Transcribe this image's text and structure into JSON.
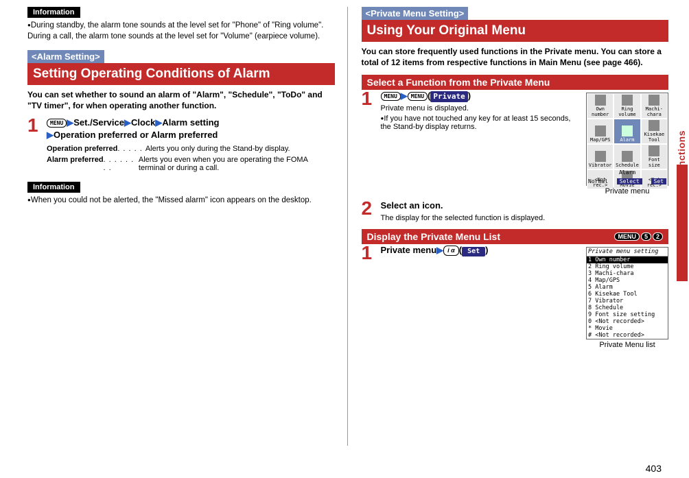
{
  "left": {
    "info1_label": "Information",
    "info1_text": "During standby, the alarm tone sounds at the level set for \"Phone\" of \"Ring volume\". During a call, the alarm tone sounds at the level set for \"Volume\" (earpiece volume).",
    "section_tag": "<Alarm Setting>",
    "section_title": "Setting Operating Conditions of Alarm",
    "intro": "You can set whether to sound an alarm of \"Alarm\", \"Schedule\", \"ToDo\" and \"TV timer\", for when operating another function.",
    "step1_menu": "MENU",
    "step1_path": "Set./Service",
    "step1_clock": "Clock",
    "step1_alarm": "Alarm setting",
    "step1_opt": "Operation preferred or Alarm preferred",
    "def1_term": "Operation preferred",
    "def1_desc": "Alerts you only during the Stand-by display.",
    "def2_term": "Alarm preferred",
    "def2_desc": "Alerts you even when you are operating the FOMA terminal or during a call.",
    "info2_label": "Information",
    "info2_text": "When you could not be alerted, the \"Missed alarm\" icon appears on the desktop."
  },
  "right": {
    "section_tag": "<Private Menu Setting>",
    "section_title": "Using Your Original Menu",
    "intro": "You can store frequently used functions in the Private menu. You can store a total of 12 items from respective functions in Main Menu (see page 466).",
    "sub1": "Select a Function from the Private Menu",
    "step1_menu": "MENU",
    "step1_priv": "Private",
    "step1_desc": "Private menu is displayed.",
    "step1_bullet": "If you have not touched any key for at least 15 seconds, the Stand-by display returns.",
    "grid": [
      "Own number",
      "Ring volume",
      "Machi-chara",
      "Map/GPS",
      "Alarm",
      "Kisekae Tool",
      "Vibrator",
      "Schedule",
      "Font size",
      "<Not rec.>",
      "Movie",
      "<Not rec.>"
    ],
    "screen_foot_label": "Alarm",
    "screen_foot_l": "Normal",
    "screen_foot_c": "Select",
    "screen_foot_r": "Set",
    "caption1": "Private menu",
    "step2_title": "Select an icon.",
    "step2_desc": "The display for the selected function is displayed.",
    "sub2": "Display the Private Menu List",
    "shortcut_a": "MENU",
    "shortcut_b": "5",
    "shortcut_c": "2",
    "step3_title_a": "Private menu",
    "step3_set": "Set",
    "list_title": "Private menu setting",
    "list_items": [
      "1 Own number",
      "2 Ring volume",
      "3 Machi-chara",
      "4 Map/GPS",
      "5 Alarm",
      "6 Kisekae Tool",
      "7 Vibrator",
      "8 Schedule",
      "9 Font size setting",
      "0  <Not recorded>",
      "* Movie",
      "#  <Not recorded>"
    ],
    "caption2": "Private Menu list"
  },
  "side": "Convenient Functions",
  "page": "403",
  "chart_data": null
}
